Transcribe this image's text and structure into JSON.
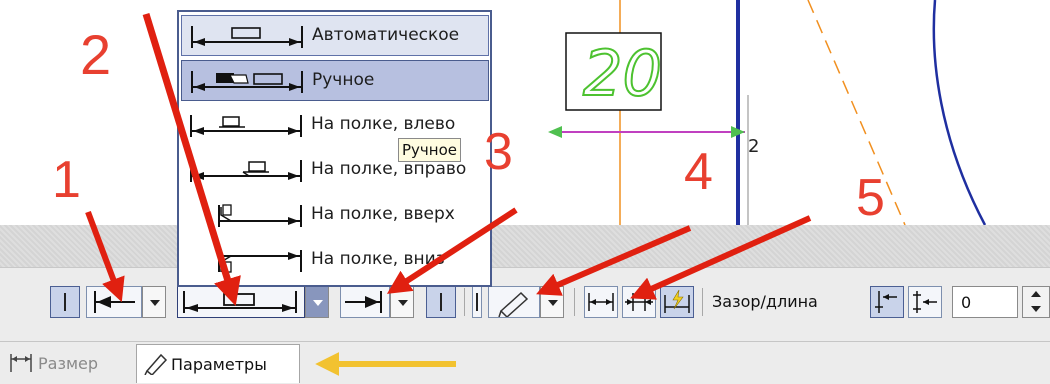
{
  "canvas": {
    "dimension_value": "20",
    "edge_digit": "2"
  },
  "dropdown": {
    "items": [
      {
        "label": "Автоматическое",
        "state": "highlighted"
      },
      {
        "label": "Ручное",
        "state": "selected"
      },
      {
        "label": "На полке, влево",
        "state": "normal"
      },
      {
        "label": "На полке, вправо",
        "state": "normal"
      },
      {
        "label": "На полке, вверх",
        "state": "normal"
      },
      {
        "label": "На полке, вниз",
        "state": "normal"
      }
    ]
  },
  "tooltip": "Ручное",
  "annotations": [
    "1",
    "2",
    "3",
    "4",
    "5"
  ],
  "toolbar": {
    "gap_length_label": "Зазор/длина",
    "gap_value": "0"
  },
  "tabs": [
    {
      "label": "Размер",
      "active": false
    },
    {
      "label": "Параметры",
      "active": true
    }
  ],
  "colors": {
    "annotation_red": "#e84030",
    "arrow_red": "#e02010",
    "tab_arrow_yellow": "#f2c230",
    "selection_blue": "#4a5c8e",
    "dimension_green": "#4dc230",
    "outline_blue": "#1f2fa0",
    "axis_orange": "#f19020"
  }
}
